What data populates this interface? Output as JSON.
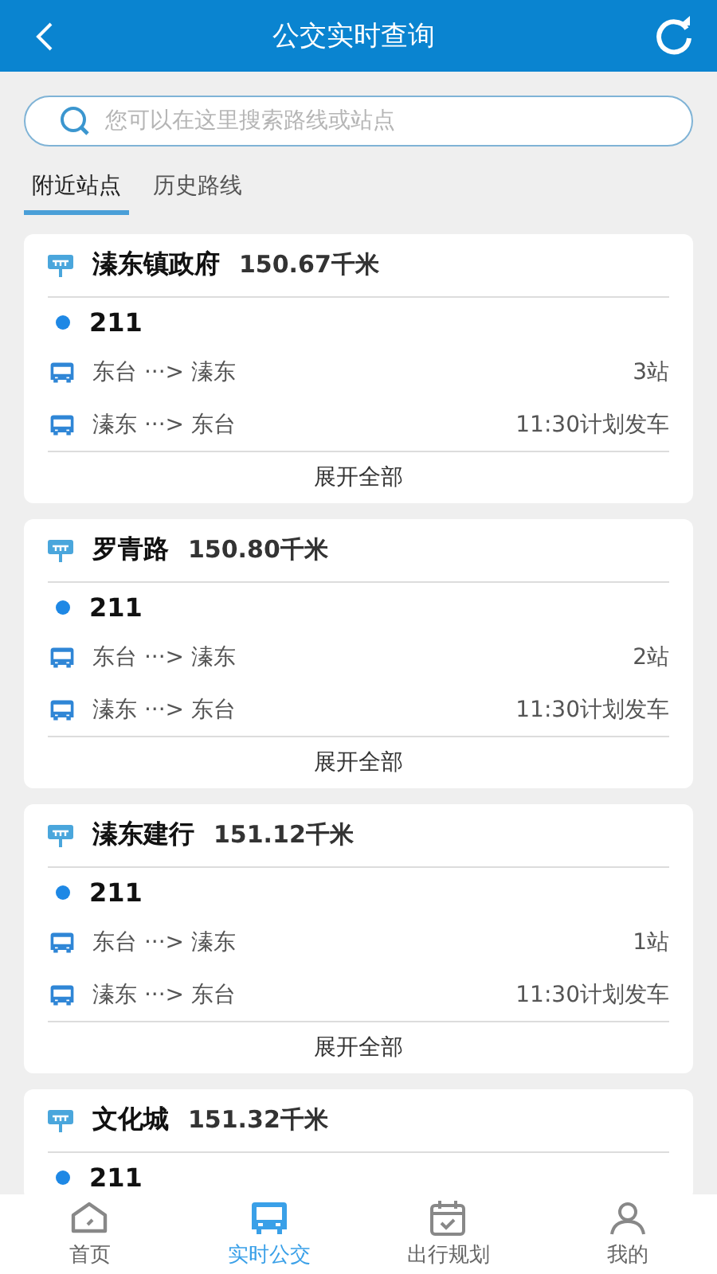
{
  "header": {
    "title": "公交实时查询"
  },
  "search": {
    "placeholder": "您可以在这里搜索路线或站点"
  },
  "tabs": [
    {
      "label": "附近站点",
      "selected": true
    },
    {
      "label": "历史路线",
      "selected": false
    }
  ],
  "stations": [
    {
      "name": "溱东镇政府",
      "distance": "150.67千米",
      "routes": [
        {
          "number": "211",
          "directions": [
            {
              "text": "东台 ···> 溱东",
              "info": "3站"
            },
            {
              "text": "溱东 ···> 东台",
              "info": "11:30计划发车"
            }
          ]
        }
      ],
      "expand": "展开全部"
    },
    {
      "name": "罗青路",
      "distance": "150.80千米",
      "routes": [
        {
          "number": "211",
          "directions": [
            {
              "text": "东台 ···> 溱东",
              "info": "2站"
            },
            {
              "text": "溱东 ···> 东台",
              "info": "11:30计划发车"
            }
          ]
        }
      ],
      "expand": "展开全部"
    },
    {
      "name": "溱东建行",
      "distance": "151.12千米",
      "routes": [
        {
          "number": "211",
          "directions": [
            {
              "text": "东台 ···> 溱东",
              "info": "1站"
            },
            {
              "text": "溱东 ···> 东台",
              "info": "11:30计划发车"
            }
          ]
        }
      ],
      "expand": "展开全部"
    },
    {
      "name": "文化城",
      "distance": "151.32千米",
      "routes": [
        {
          "number": "211"
        }
      ]
    }
  ],
  "nav": [
    {
      "kind": "home",
      "label": "首页",
      "selected": false
    },
    {
      "kind": "bus",
      "label": "实时公交",
      "selected": true
    },
    {
      "kind": "calendar",
      "label": "出行规划",
      "selected": false
    },
    {
      "kind": "user",
      "label": "我的",
      "selected": false
    }
  ]
}
